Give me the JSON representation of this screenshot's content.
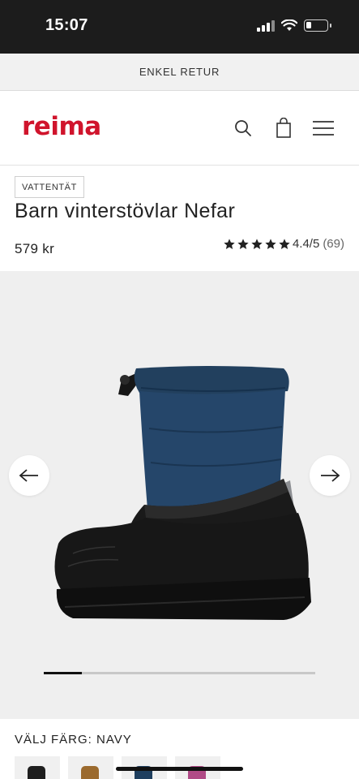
{
  "status_bar": {
    "time": "15:07",
    "icons": [
      "signal-icon",
      "wifi-icon",
      "battery-icon"
    ],
    "battery_level": 0.25
  },
  "promo": {
    "text": "ENKEL RETUR"
  },
  "header": {
    "logo_text": "reima",
    "brand_color": "#d0142c",
    "icons": [
      "search-icon",
      "shopping-bag-icon",
      "hamburger-menu-icon"
    ]
  },
  "product": {
    "badge": "VATTENTÄT",
    "title": "Barn vinterstövlar Nefar",
    "price": "579 kr",
    "rating": {
      "stars_filled": 5,
      "score_text": "4.4/5",
      "count_text": "(69)"
    }
  },
  "gallery": {
    "prev_icon": "arrow-left-icon",
    "next_icon": "arrow-right-icon",
    "progress": 0.14,
    "image_description_icon": "boot-image"
  },
  "color_picker": {
    "label": "VÄLJ FÄRG: NAVY",
    "swatch_colors": [
      "#1e1e1e",
      "#9b6a2e",
      "#1f3f5f",
      "#b04a86"
    ]
  }
}
